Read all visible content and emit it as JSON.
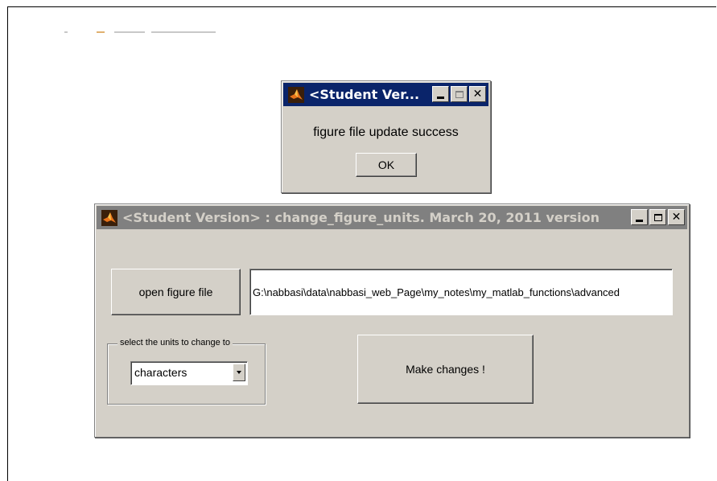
{
  "message_dialog": {
    "title": "<Student Ver...",
    "message": "figure file update success",
    "ok_label": "OK"
  },
  "main_window": {
    "title": "<Student Version> : change_figure_units. March 20, 2011 version",
    "open_button_label": "open figure file",
    "file_path": "G:\\nabbasi\\data\\nabbasi_web_Page\\my_notes\\my_matlab_functions\\advanced",
    "units_group_label": "select the units to change to",
    "units_selected": "characters",
    "make_changes_label": "Make changes !"
  },
  "titlebar_buttons": {
    "minimize": "_",
    "close": "✕"
  },
  "colors": {
    "active_title": "#0a246a",
    "inactive_title": "#808080",
    "face": "#d4d0c8"
  },
  "icons": {
    "app": "matlab-logo-icon"
  }
}
